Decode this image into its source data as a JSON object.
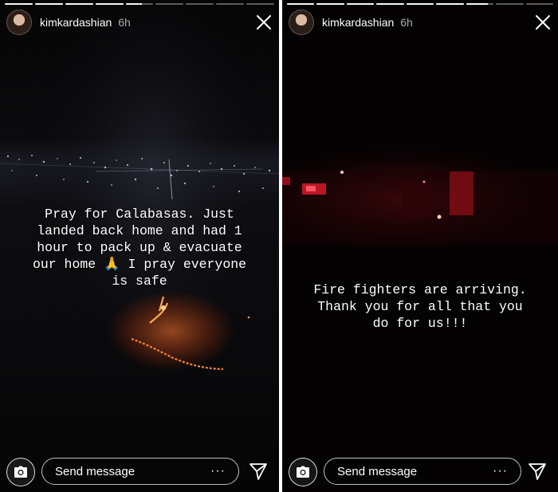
{
  "stories": [
    {
      "username": "kimkardashian",
      "timestamp": "6h",
      "progress": [
        1,
        1,
        1,
        1,
        0.6,
        0,
        0,
        0,
        0
      ],
      "caption": "Pray for Calabasas. Just\nlanded back home and had 1\nhour to pack up & evacuate\nour home 🙏 I pray everyone\nis safe",
      "message_placeholder": "Send message",
      "more_label": "···"
    },
    {
      "username": "kimkardashian",
      "timestamp": "6h",
      "progress": [
        1,
        1,
        1,
        1,
        1,
        1,
        0.8,
        0,
        0
      ],
      "caption": "Fire fighters are arriving.\nThank you for all that you\ndo for us!!!",
      "message_placeholder": "Send message",
      "more_label": "···"
    }
  ],
  "icons": {
    "camera": "camera-icon",
    "close": "close-icon",
    "send": "send-icon",
    "more": "more-icon"
  }
}
